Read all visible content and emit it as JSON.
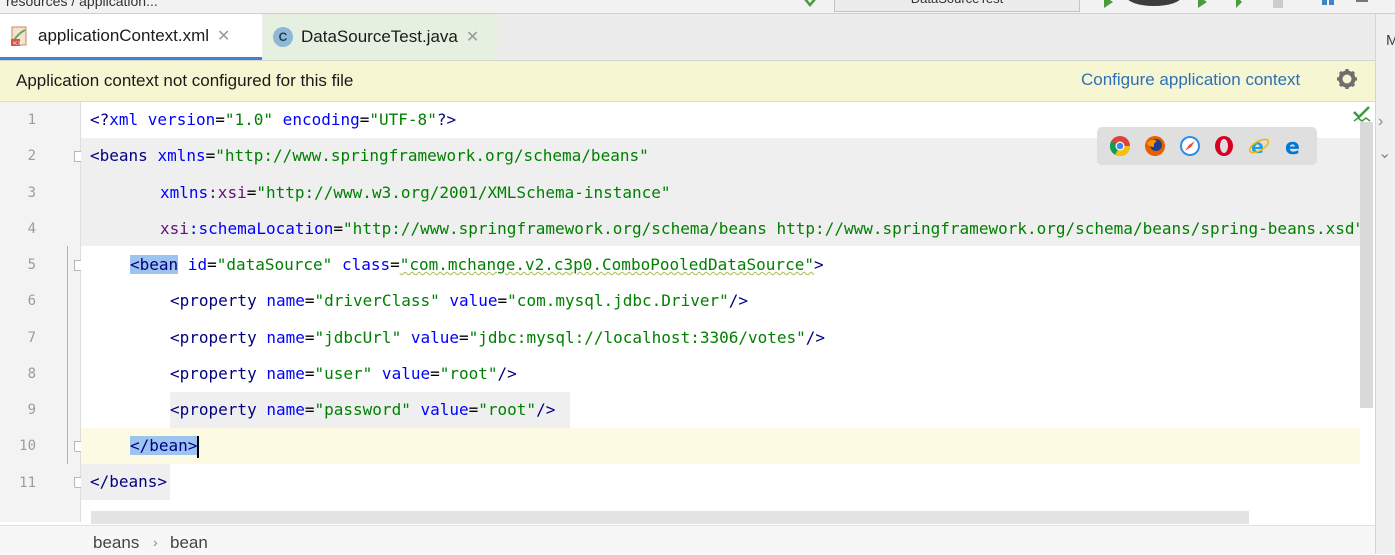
{
  "topbar": {
    "crumb_text": "resources / application...",
    "run_config": "DataSourceTest"
  },
  "tabs": [
    {
      "label": "applicationContext.xml",
      "icon": "spring-xml-file-icon",
      "active": true
    },
    {
      "label": "DataSourceTest.java",
      "icon": "java-class-icon",
      "active": false
    }
  ],
  "tab_close_glyph": "✕",
  "right_strip_label": "M",
  "notice": {
    "message": "Application context not configured for this file",
    "link": "Configure application context"
  },
  "line_numbers": [
    "1",
    "2",
    "3",
    "4",
    "5",
    "6",
    "7",
    "8",
    "9",
    "10",
    "11"
  ],
  "code": {
    "l1": {
      "a": "<?",
      "b": "xml version",
      "c": "=",
      "d": "\"1.0\"",
      "e": " encoding",
      "f": "=",
      "g": "\"UTF-8\"",
      "h": "?>"
    },
    "l2": {
      "a": "<beans ",
      "b": "xmlns",
      "c": "=",
      "d": "\"http://www.springframework.org/schema/beans\""
    },
    "l3": {
      "a": "xmlns",
      "b": ":xsi",
      "c": "=",
      "d": "\"http://www.w3.org/2001/XMLSchema-instance\""
    },
    "l4": {
      "a": "xsi",
      "b": ":schemaLocation",
      "c": "=",
      "d": "\"http://www.springframework.org/schema/beans http://www.springframework.org/schema/beans/spring-beans.xsd\""
    },
    "l5": {
      "a": "<bean",
      "b": " id",
      "c": "=",
      "d": "\"dataSource\"",
      "e": " class",
      "f": "=",
      "g": "\"com.mchange.v2.c3p0.ComboPooledDataSource\"",
      "h": ">"
    },
    "l6": {
      "a": "<property ",
      "b": "name",
      "c": "=",
      "d": "\"driverClass\"",
      "e": " value",
      "f": "=",
      "g": "\"com.mysql.jdbc.Driver\"",
      "h": "/>"
    },
    "l7": {
      "a": "<property ",
      "b": "name",
      "c": "=",
      "d": "\"jdbcUrl\"",
      "e": " value",
      "f": "=",
      "g": "\"jdbc:mysql://localhost:3306/votes\"",
      "h": "/>"
    },
    "l8": {
      "a": "<property ",
      "b": "name",
      "c": "=",
      "d": "\"user\"",
      "e": " value",
      "f": "=",
      "g": "\"root\"",
      "h": "/>"
    },
    "l9": {
      "a": "<property ",
      "b": "name",
      "c": "=",
      "d": "\"password\"",
      "e": " value",
      "f": "=",
      "g": "\"root\"",
      "h": "/>"
    },
    "l10": {
      "a": "</bean>"
    },
    "l11": {
      "a": "</beans>"
    }
  },
  "browsers": [
    "chrome-icon",
    "firefox-icon",
    "safari-icon",
    "opera-icon",
    "ie-icon",
    "edge-icon"
  ],
  "breadcrumb": [
    "beans",
    "bean"
  ],
  "breadcrumb_separator": "›",
  "colors": {
    "accent": "#4083c9",
    "notice_bg": "#f7f6d2",
    "link": "#2d70b8",
    "tag": "#000080",
    "attr": "#0000ff",
    "value": "#008000",
    "namespace": "#660e7a"
  }
}
